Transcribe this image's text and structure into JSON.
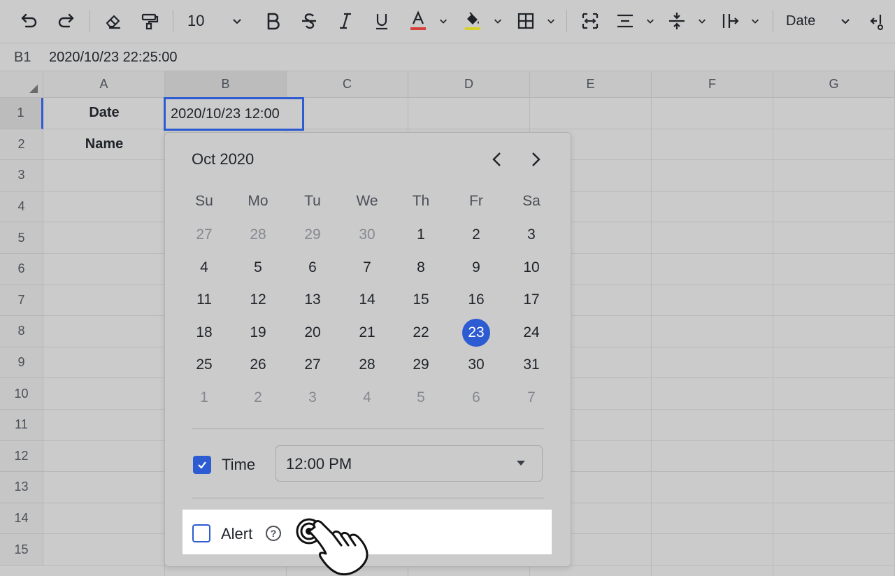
{
  "toolbar": {
    "font_size": "10",
    "format_label": "Date",
    "icons": [
      "undo-icon",
      "redo-icon",
      "eraser-icon",
      "format-painter-icon",
      "bold-icon",
      "strikethrough-icon",
      "italic-icon",
      "underline-icon",
      "text-color-icon",
      "fill-color-icon",
      "borders-icon",
      "merge-cells-icon",
      "horizontal-align-icon",
      "vertical-align-icon",
      "text-wrap-icon",
      "more-icon"
    ],
    "text_color": "#d6403a",
    "fill_color": "#d4d22a"
  },
  "formula_bar": {
    "cell_ref": "B1",
    "value": "2020/10/23 22:25:00"
  },
  "sheet": {
    "columns": [
      "A",
      "B",
      "C",
      "D",
      "E",
      "F",
      "G"
    ],
    "rows": [
      "1",
      "2",
      "3",
      "4",
      "5",
      "6",
      "7",
      "8",
      "9",
      "10",
      "11",
      "12",
      "13",
      "14",
      "15"
    ],
    "cells": {
      "A1": "Date",
      "A2": "Name"
    },
    "active_cell_value": "2020/10/23 12:00"
  },
  "date_picker": {
    "month_label": "Oct 2020",
    "weekdays": [
      "Su",
      "Mo",
      "Tu",
      "We",
      "Th",
      "Fr",
      "Sa"
    ],
    "weeks": [
      [
        "27",
        "28",
        "29",
        "30",
        "1",
        "2",
        "3"
      ],
      [
        "4",
        "5",
        "6",
        "7",
        "8",
        "9",
        "10"
      ],
      [
        "11",
        "12",
        "13",
        "14",
        "15",
        "16",
        "17"
      ],
      [
        "18",
        "19",
        "20",
        "21",
        "22",
        "23",
        "24"
      ],
      [
        "25",
        "26",
        "27",
        "28",
        "29",
        "30",
        "31"
      ],
      [
        "1",
        "2",
        "3",
        "4",
        "5",
        "6",
        "7"
      ]
    ],
    "selected_day": "23",
    "time_label": "Time",
    "time_enabled": true,
    "time_value": "12:00 PM",
    "alert_label": "Alert",
    "alert_enabled": false,
    "help_glyph": "?",
    "accent_color": "#2d5bd1"
  }
}
